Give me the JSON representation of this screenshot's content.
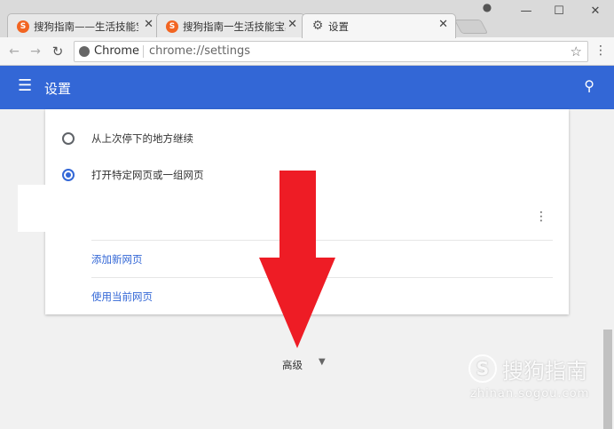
{
  "tabs": [
    {
      "title": "搜狗指南——生活技能宝",
      "favicon": "sogou-icon",
      "close": "✕"
    },
    {
      "title": "搜狗指南一生活技能宝典",
      "favicon": "sogou-icon",
      "close": "✕"
    },
    {
      "title": "设置",
      "favicon": "gear-icon",
      "close": "✕",
      "active": true
    }
  ],
  "window": {
    "minimize": "—",
    "maximize": "☐",
    "close": "✕"
  },
  "omnibox": {
    "chip": "Chrome",
    "url": "chrome://settings"
  },
  "header": {
    "title": "设置"
  },
  "startup": {
    "options": [
      {
        "label": "从上次停下的地方继续",
        "selected": false
      },
      {
        "label": "打开特定网页或一组网页",
        "selected": true
      }
    ],
    "links": {
      "add_page": "添加新网页",
      "use_current": "使用当前网页"
    }
  },
  "advanced_label": "高级",
  "watermark": {
    "logo": "S",
    "brand": "搜狗指南",
    "site": "zhinan.sogou.com"
  },
  "colors": {
    "accent": "#3367d6",
    "arrow": "#ee1c25"
  }
}
